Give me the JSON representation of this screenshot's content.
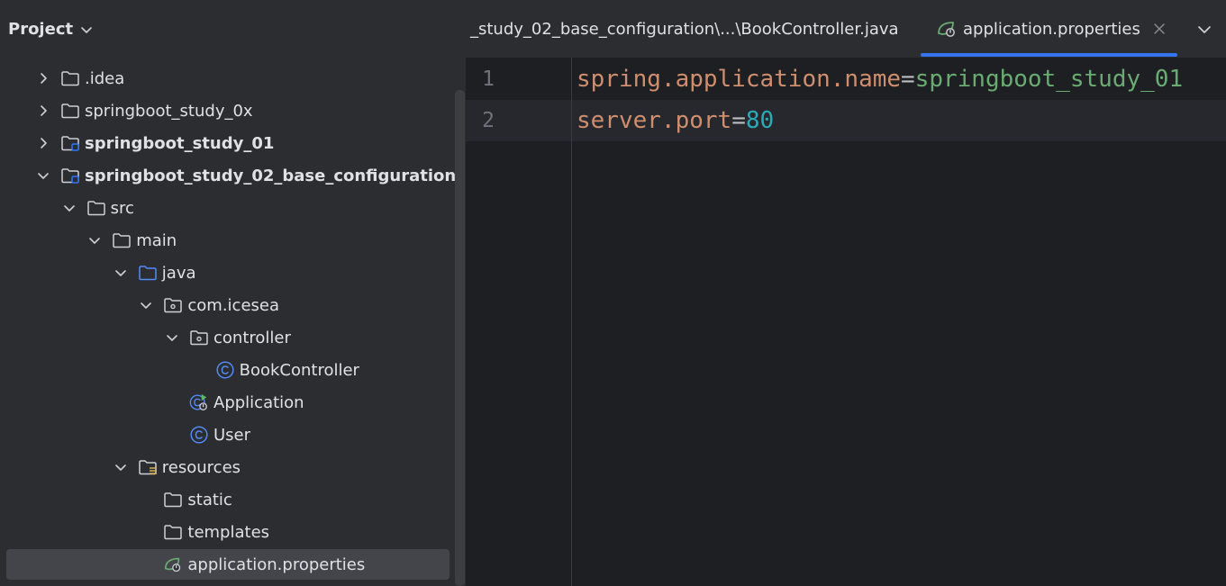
{
  "project_panel": {
    "title": "Project",
    "tree": [
      {
        "label": ".idea",
        "indent": 0,
        "arrow": "right",
        "icon": "folder-icon",
        "bold": false
      },
      {
        "label": "springboot_study_0x",
        "indent": 0,
        "arrow": "right",
        "icon": "folder-icon",
        "bold": false
      },
      {
        "label": "springboot_study_01",
        "indent": 0,
        "arrow": "right",
        "icon": "module-folder-icon",
        "bold": true
      },
      {
        "label": "springboot_study_02_base_configuration",
        "indent": 0,
        "arrow": "down",
        "icon": "module-folder-icon",
        "bold": true
      },
      {
        "label": "src",
        "indent": 1,
        "arrow": "down",
        "icon": "folder-icon",
        "bold": false
      },
      {
        "label": "main",
        "indent": 2,
        "arrow": "down",
        "icon": "folder-icon",
        "bold": false
      },
      {
        "label": "java",
        "indent": 3,
        "arrow": "down",
        "icon": "source-folder-icon",
        "bold": false
      },
      {
        "label": "com.icesea",
        "indent": 4,
        "arrow": "down",
        "icon": "package-icon",
        "bold": false
      },
      {
        "label": "controller",
        "indent": 5,
        "arrow": "down",
        "icon": "package-icon",
        "bold": false
      },
      {
        "label": "BookController",
        "indent": 6,
        "arrow": "none",
        "icon": "class-icon",
        "bold": false
      },
      {
        "label": "Application",
        "indent": 5,
        "arrow": "none",
        "icon": "spring-boot-class-icon",
        "bold": false
      },
      {
        "label": "User",
        "indent": 5,
        "arrow": "none",
        "icon": "class-icon",
        "bold": false
      },
      {
        "label": "resources",
        "indent": 3,
        "arrow": "down",
        "icon": "resources-folder-icon",
        "bold": false
      },
      {
        "label": "static",
        "indent": 4,
        "arrow": "none",
        "icon": "folder-icon",
        "bold": false
      },
      {
        "label": "templates",
        "indent": 4,
        "arrow": "none",
        "icon": "folder-icon",
        "bold": false
      },
      {
        "label": "application.properties",
        "indent": 4,
        "arrow": "none",
        "icon": "spring-properties-icon",
        "bold": false,
        "selected": true
      }
    ]
  },
  "editor": {
    "tabs": [
      {
        "label": "_study_02_base_configuration\\...\\BookController.java",
        "active": false
      },
      {
        "label": "application.properties",
        "active": true,
        "icon": "spring-properties-icon"
      }
    ],
    "lines": [
      {
        "number": "1",
        "key": "spring.application.name",
        "eq": "=",
        "value": "springboot_study_01",
        "value_type": "string"
      },
      {
        "number": "2",
        "key": "server.port",
        "eq": "=",
        "value": "80",
        "value_type": "number"
      }
    ],
    "current_line": 2
  },
  "colors": {
    "accent": "#3574f0",
    "panel_bg": "#2b2d30",
    "editor_bg": "#1e1f22",
    "key": "#cf8e6d",
    "string": "#6aab73",
    "number": "#2aacb8"
  }
}
